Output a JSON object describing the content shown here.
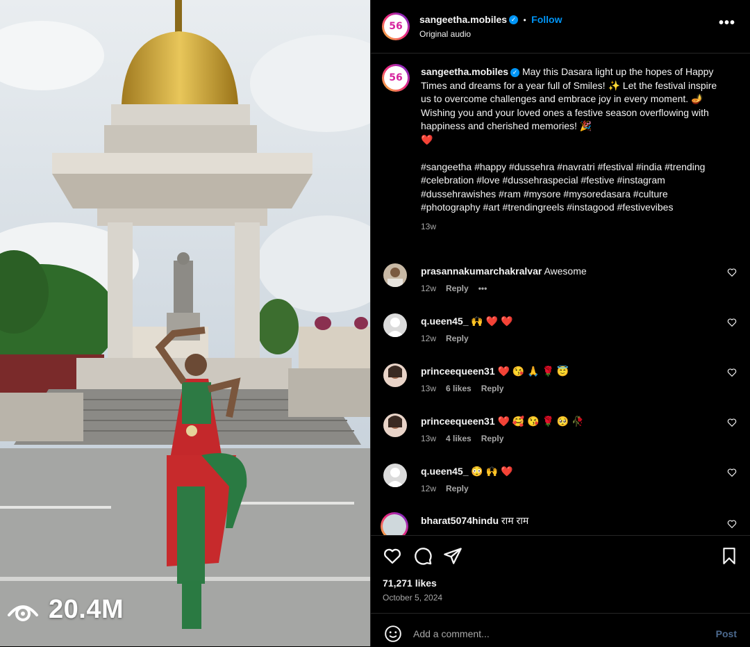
{
  "media": {
    "view_count": "20.4M",
    "icon": "eye-icon"
  },
  "header": {
    "username": "sangeetha.mobiles",
    "separator": "•",
    "follow_label": "Follow",
    "audio": "Original audio",
    "more_icon": "more-options-icon",
    "avatar_text": "56"
  },
  "caption": {
    "username": "sangeetha.mobiles",
    "text": "May this Dasara light up the hopes of Happy Times and dreams for a year full of Smiles! ✨ Let the festival inspire us to overcome challenges and embrace joy in every moment. 🪔 Wishing you and your loved ones a festive season overflowing with happiness and cherished memories! 🎉",
    "heart": "❤️",
    "hashtags": "#sangeetha #happy #dussehra #navratri #festival #india #trending #celebration #love #dussehraspecial #festive #instagram #dussehrawishes #ram #mysore #mysoredasara #culture #photography #art #trendingreels #instagood #festivevibes",
    "time": "13w"
  },
  "comments": [
    {
      "username": "prasannakumarchakralvar",
      "text": "Awesome",
      "time": "12w",
      "likes": "",
      "reply": "Reply",
      "more": "•••"
    },
    {
      "username": "q.ueen45_",
      "text": "🙌 ❤️ ❤️",
      "time": "12w",
      "likes": "",
      "reply": "Reply"
    },
    {
      "username": "princeequeen31",
      "text": "❤️ 😘 🙏 🌹 😇",
      "time": "13w",
      "likes": "6 likes",
      "reply": "Reply"
    },
    {
      "username": "princeequeen31",
      "text": "❤️ 🥰 😘 🌹 🥺 🥀",
      "time": "13w",
      "likes": "4 likes",
      "reply": "Reply"
    },
    {
      "username": "q.ueen45_",
      "text": "😳 🙌 ❤️",
      "time": "12w",
      "likes": "",
      "reply": "Reply"
    },
    {
      "username": "bharat5074hindu",
      "text": "राम राम",
      "time": "",
      "likes": "",
      "reply": ""
    }
  ],
  "actions": {
    "like_icon": "heart-icon",
    "comment_icon": "comment-icon",
    "share_icon": "share-icon",
    "save_icon": "bookmark-icon",
    "likes": "71,271 likes",
    "date": "October 5, 2024"
  },
  "add_comment": {
    "emoji_icon": "emoji-icon",
    "placeholder": "Add a comment...",
    "post_label": "Post"
  },
  "colors": {
    "background": "#000000",
    "accent_blue": "#0095f6",
    "secondary_text": "#a8a8a8",
    "heart_red": "#ed4956"
  }
}
